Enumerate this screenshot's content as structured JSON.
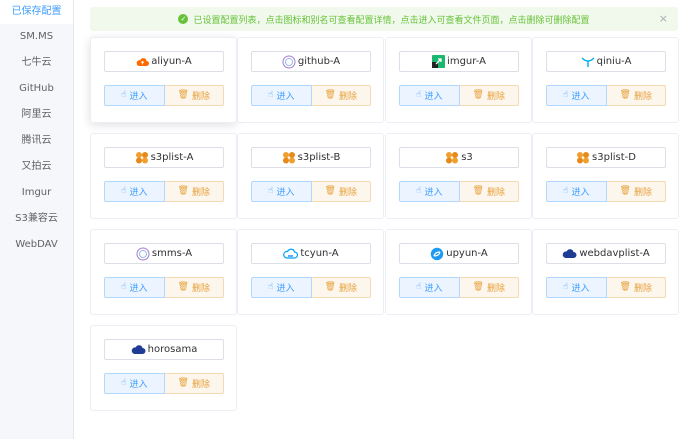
{
  "sidebar": {
    "items": [
      {
        "label": "已保存配置",
        "active": true
      },
      {
        "label": "SM.MS"
      },
      {
        "label": "七牛云"
      },
      {
        "label": "GitHub"
      },
      {
        "label": "阿里云"
      },
      {
        "label": "腾讯云"
      },
      {
        "label": "又拍云"
      },
      {
        "label": "Imgur"
      },
      {
        "label": "S3兼容云"
      },
      {
        "label": "WebDAV"
      }
    ]
  },
  "alert": {
    "text": "已设置配置列表，点击图标和别名可查看配置详情，点击进入可查看文件页面，点击删除可删除配置",
    "close": "×",
    "color": "#67c23a"
  },
  "buttons": {
    "enter": "进入",
    "delete": "删除"
  },
  "colors": {
    "accent": "#409eff",
    "warning": "#e6a23c",
    "success": "#67c23a"
  },
  "configs": [
    {
      "name": "aliyun-A",
      "icon": "aliyun-cloud-icon"
    },
    {
      "name": "github-A",
      "icon": "github-icon"
    },
    {
      "name": "imgur-A",
      "icon": "imgur-icon"
    },
    {
      "name": "qiniu-A",
      "icon": "qiniu-icon"
    },
    {
      "name": "s3plist-A",
      "icon": "s3-bucket-icon"
    },
    {
      "name": "s3plist-B",
      "icon": "s3-bucket-icon"
    },
    {
      "name": "s3",
      "icon": "s3-bucket-icon"
    },
    {
      "name": "s3plist-D",
      "icon": "s3-bucket-icon"
    },
    {
      "name": "smms-A",
      "icon": "smms-icon"
    },
    {
      "name": "tcyun-A",
      "icon": "tencent-cloud-icon"
    },
    {
      "name": "upyun-A",
      "icon": "upyun-icon"
    },
    {
      "name": "webdavplist-A",
      "icon": "webdav-cloud-icon"
    },
    {
      "name": "horosama",
      "icon": "webdav-cloud-icon"
    }
  ]
}
